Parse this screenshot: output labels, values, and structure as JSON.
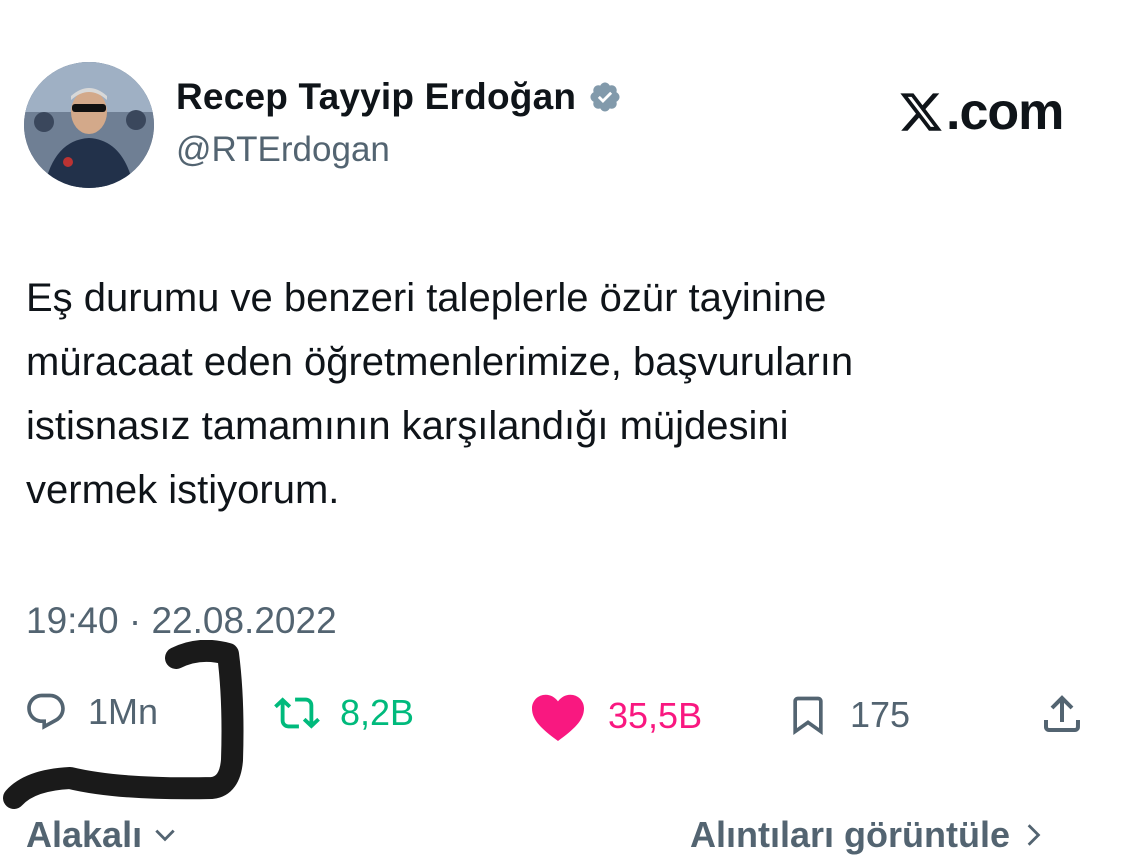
{
  "header": {
    "display_name": "Recep Tayyip Erdoğan",
    "handle": "@RTErdogan",
    "verified_icon": "verified-badge-icon",
    "brand_text": ".com",
    "brand_icon": "x-logo-icon"
  },
  "tweet": {
    "lines": [
      "Eş durumu ve benzeri taleplerle özür tayinine",
      "müracaat eden öğretmenlerimize, başvuruların",
      "istisnasız tamamının karşılandığı müjdesini",
      "vermek istiyorum."
    ],
    "timestamp": "19:40 · 22.08.2022"
  },
  "actions": {
    "replies": "1Mn",
    "retweets": "8,2B",
    "likes": "35,5B",
    "bookmarks": "175"
  },
  "footer": {
    "left_label": "Alakalı",
    "right_label": "Alıntıları görüntüle"
  },
  "colors": {
    "text": "#0f1419",
    "secondary": "#536471",
    "retweet": "#00ba7c",
    "like": "#f91880",
    "marker": "#1a1a1a"
  }
}
